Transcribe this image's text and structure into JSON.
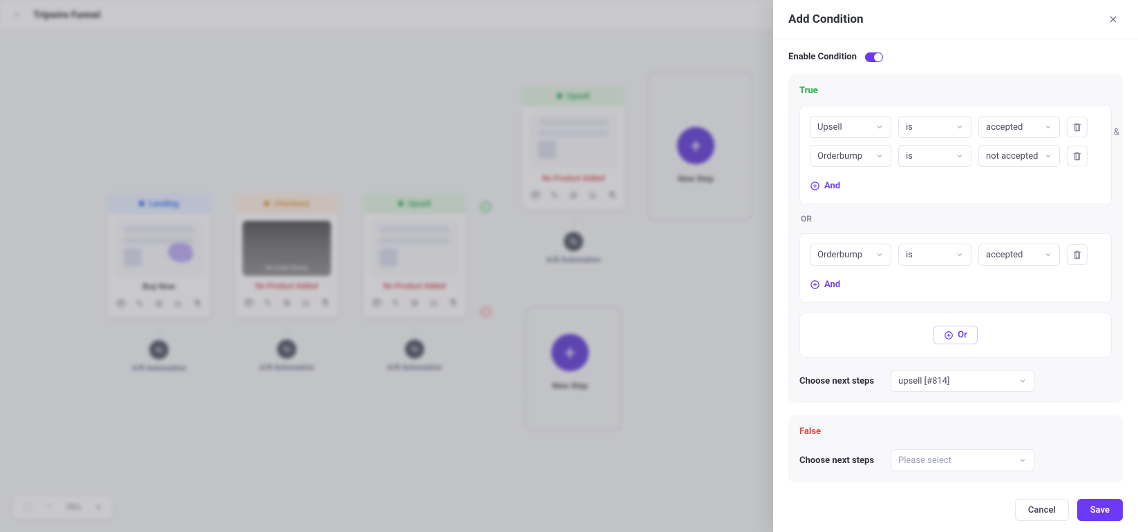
{
  "topbar": {
    "title": "Tripwire Funnel"
  },
  "canvas": {
    "zoom": "76%",
    "steps": {
      "landing": {
        "header": "Landing",
        "caption": "Buy Now",
        "ab": "A/B Automation"
      },
      "checkout": {
        "header": "Checkout",
        "caption": "No Product Added",
        "overlay": "No Order Bump",
        "ab": "A/B Automation"
      },
      "upsell1": {
        "header": "Upsell",
        "caption": "No Product Added",
        "ab": "A/B Automation"
      },
      "upsell2": {
        "header": "Upsell",
        "caption": "No Product Added",
        "ab": "A/B Automation"
      }
    },
    "new_step": "New Step"
  },
  "panel": {
    "title": "Add Condition",
    "enable_label": "Enable Condition",
    "true_label": "True",
    "false_label": "False",
    "or_separator": "OR",
    "and_label": "And",
    "or_button": "Or",
    "amp": "&",
    "choose_label": "Choose next steps",
    "true_groups": [
      {
        "rows": [
          {
            "field": "Upsell",
            "op": "is",
            "value": "accepted"
          },
          {
            "field": "Orderbump",
            "op": "is",
            "value": "not accepted"
          }
        ]
      },
      {
        "rows": [
          {
            "field": "Orderbump",
            "op": "is",
            "value": "accepted"
          }
        ]
      }
    ],
    "true_next": "upsell [#814]",
    "false_next": "Please select",
    "cancel": "Cancel",
    "save": "Save"
  }
}
